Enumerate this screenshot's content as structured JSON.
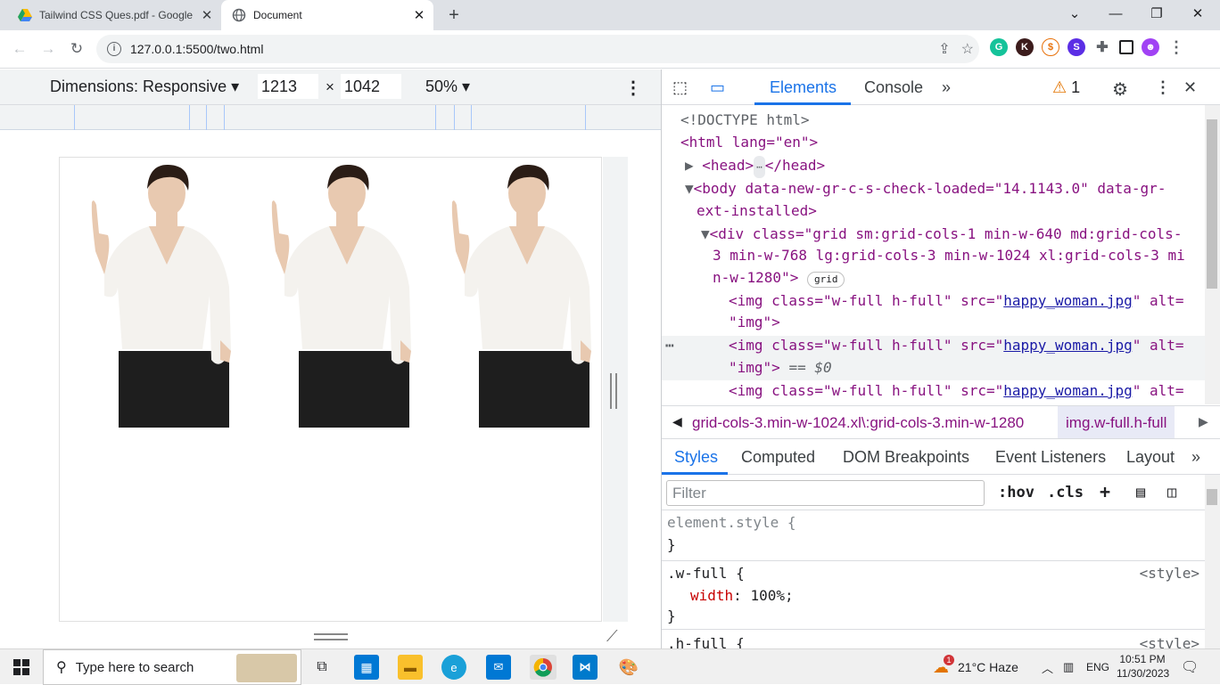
{
  "browser": {
    "tabs": [
      {
        "title": "Tailwind CSS Ques.pdf - Google",
        "icon": "google-drive-icon"
      },
      {
        "title": "Document",
        "icon": "globe-icon"
      }
    ],
    "url": "127.0.0.1:5500/two.html"
  },
  "device_toolbar": {
    "dimensions_label": "Dimensions: Responsive",
    "width": "1213",
    "height": "1042",
    "times": "×",
    "zoom": "50%"
  },
  "devtools": {
    "tabs": [
      "Elements",
      "Console"
    ],
    "warning_count": "1",
    "dom_lines": [
      "<!DOCTYPE html>",
      "<html lang=\"en\">",
      "<head>",
      "</head>",
      "<body data-new-gr-c-s-check-loaded=\"14.1143.0\" data-gr-",
      "ext-installed>",
      "<div class=\"grid sm:grid-cols-1 min-w-640 md:grid-cols-",
      "3 min-w-768 lg:grid-cols-3 min-w-1024 xl:grid-cols-3 mi",
      "n-w-1280\">",
      "grid",
      "<img class=\"w-full h-full\" src=\"",
      "happy_woman.jpg",
      "\" alt=",
      "\"img\">",
      "== $0"
    ],
    "breadcrumbs": [
      "grid-cols-3.min-w-1024.xl\\:grid-cols-3.min-w-1280",
      "img.w-full.h-full"
    ],
    "style_tabs": [
      "Styles",
      "Computed",
      "DOM Breakpoints",
      "Event Listeners",
      "Layout"
    ],
    "filter_placeholder": "Filter",
    "hov": ":hov",
    "cls": ".cls",
    "styles": {
      "element_style": "element.style {",
      "close": "}",
      "w_full_selector": ".w-full {",
      "w_full_prop": "width",
      "w_full_value": "100%;",
      "h_full_selector": ".h-full {",
      "source": "<style>"
    }
  },
  "taskbar": {
    "search_placeholder": "Type here to search",
    "weather": "21°C  Haze",
    "language": "ENG",
    "time": "10:51 PM",
    "date": "11/30/2023",
    "weather_badge": "1"
  },
  "colors": {
    "accent": "#1a73e8",
    "tag": "#881280",
    "attr": "#994500",
    "value": "#1a1aa6"
  }
}
